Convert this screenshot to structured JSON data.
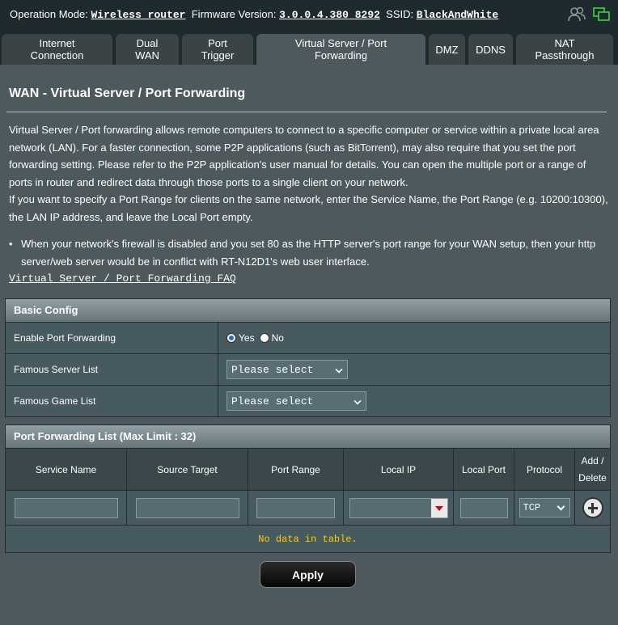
{
  "topbar": {
    "operation_mode_label": "Operation Mode:",
    "operation_mode_value": "Wireless router",
    "firmware_label": "Firmware Version:",
    "firmware_value": "3.0.0.4.380_8292",
    "ssid_label": "SSID:",
    "ssid_value": "BlackAndWhite",
    "icons": [
      "users-icon",
      "network-icon"
    ]
  },
  "tabs": [
    {
      "label": "Internet\nConnection"
    },
    {
      "label": "Dual\nWAN"
    },
    {
      "label": "Port\nTrigger"
    },
    {
      "label": "Virtual Server / Port\nForwarding"
    },
    {
      "label": "DMZ"
    },
    {
      "label": "DDNS"
    },
    {
      "label": "NAT\nPassthrough"
    }
  ],
  "page": {
    "title": "WAN - Virtual Server / Port Forwarding",
    "description_1": "Virtual Server / Port forwarding allows remote computers to connect to a specific computer or service within a private local area network (LAN). For a faster connection, some P2P applications (such as BitTorrent), may also require that you set the port forwarding setting. Please refer to the P2P application's user manual for details. You can open the multiple port or a range of ports in router and redirect data through those ports to a single client on your network.",
    "description_2": "If you want to specify a Port Range for clients on the same network, enter the Service Name, the Port Range (e.g. 10200:10300), the LAN IP address, and leave the Local Port empty.",
    "bullet": "When your network's firewall is disabled and you set 80 as the HTTP server's port range for your WAN setup, then your http server/web server would be in conflict with RT-N12D1's web user interface.",
    "faq_link": "Virtual Server / Port Forwarding FAQ"
  },
  "basic_config": {
    "header": "Basic Config",
    "enable_label": "Enable Port Forwarding",
    "yes_label": "Yes",
    "no_label": "No",
    "enabled": "yes",
    "famous_server_label": "Famous Server List",
    "famous_server_value": "Please select",
    "famous_game_label": "Famous Game List",
    "famous_game_value": "Please select"
  },
  "pf_list": {
    "header": "Port Forwarding List (Max Limit : 32)",
    "columns": [
      "Service Name",
      "Source Target",
      "Port Range",
      "Local IP",
      "Local Port",
      "Protocol",
      "Add /\nDelete"
    ],
    "protocol_value": "TCP",
    "empty_message": "No data in table."
  },
  "apply_label": "Apply"
}
